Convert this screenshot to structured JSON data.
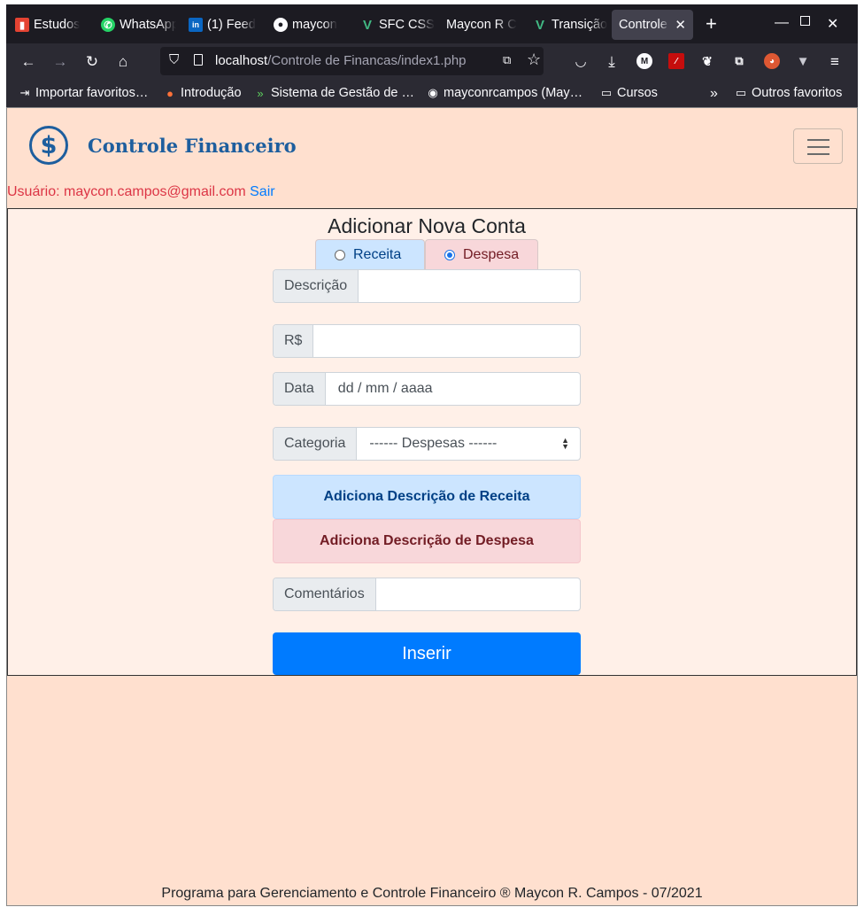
{
  "browser": {
    "tabs": [
      {
        "title": "Estudos"
      },
      {
        "title": "WhatsApp"
      },
      {
        "title": "(1) Feed"
      },
      {
        "title": "maycon"
      },
      {
        "title": "SFC CSS"
      },
      {
        "title": "Maycon R C"
      },
      {
        "title": "Transição"
      },
      {
        "title": "Controle"
      }
    ],
    "new_tab": "+",
    "url_host": "localhost",
    "url_path": "/Controle de Financas/index1.php",
    "bookmarks": [
      {
        "label": "Importar favoritos…"
      },
      {
        "label": "Introdução"
      },
      {
        "label": "Sistema de Gestão de …"
      },
      {
        "label": "mayconrcampos (May…"
      },
      {
        "label": "Cursos"
      },
      {
        "label": "Outros favoritos"
      }
    ]
  },
  "header": {
    "brand": "Controle Financeiro",
    "logo_symbol": "$"
  },
  "user": {
    "text": "Usuário: maycon.campos@gmail.com",
    "logout": "Sair"
  },
  "form": {
    "title": "Adicionar Nova Conta",
    "type_options": [
      {
        "label": "Receita",
        "selected": false
      },
      {
        "label": "Despesa",
        "selected": true
      }
    ],
    "descricao_label": "Descrição",
    "descricao_value": "",
    "valor_label": "R$",
    "valor_value": "",
    "data_label": "Data",
    "data_placeholder": "dd / mm / aaaa",
    "categoria_label": "Categoria",
    "categoria_selected": "------ Despesas ------",
    "add_receita_button": "Adiciona Descrição de Receita",
    "add_despesa_button": "Adiciona Descrição de Despesa",
    "comentarios_label": "Comentários",
    "comentarios_value": "",
    "submit": "Inserir"
  },
  "footer": {
    "text": "Programa para Gerenciamento e Controle Financeiro ® Maycon R. Campos - 07/2021"
  },
  "colors": {
    "page_bg": "#ffe0cf",
    "brand": "#1d5e9e",
    "user_text": "#dc3545",
    "link": "#007bff",
    "receita_bg": "#cce5ff",
    "despesa_bg": "#f8d7da",
    "submit_bg": "#007bff"
  }
}
